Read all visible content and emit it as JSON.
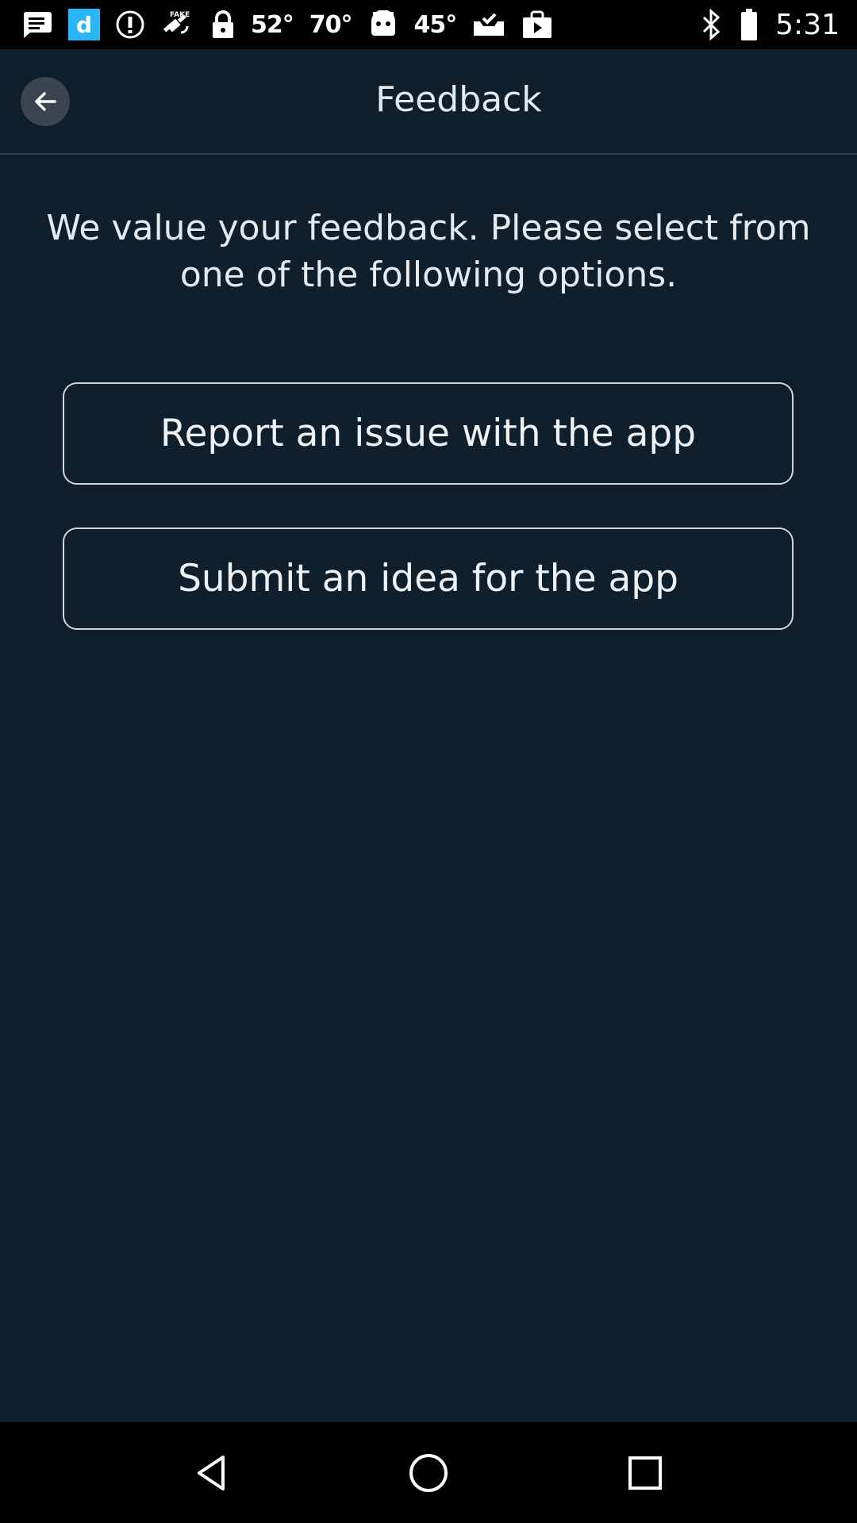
{
  "status_bar": {
    "temps": [
      "52°",
      "70°",
      "45°"
    ],
    "time": "5:31",
    "icons": [
      "message-icon",
      "app-d-icon",
      "info-icon",
      "fake-gps-icon",
      "lock-icon",
      "robot-icon",
      "mail-check-icon",
      "play-bag-icon",
      "bluetooth-icon"
    ]
  },
  "header": {
    "title": "Feedback",
    "back_icon": "arrow-left-icon"
  },
  "main": {
    "intro": "We value your feedback. Please select from one of the following options.",
    "options": [
      {
        "label": "Report an issue with the app"
      },
      {
        "label": "Submit an idea for the app"
      }
    ]
  },
  "nav": {
    "icons": [
      "back-triangle-icon",
      "home-circle-icon",
      "recents-square-icon"
    ]
  },
  "colors": {
    "background": "#0f1f2c",
    "text": "#e4eaee",
    "button_border": "#cfd6dc",
    "back_button_bg": "#3a4550"
  }
}
